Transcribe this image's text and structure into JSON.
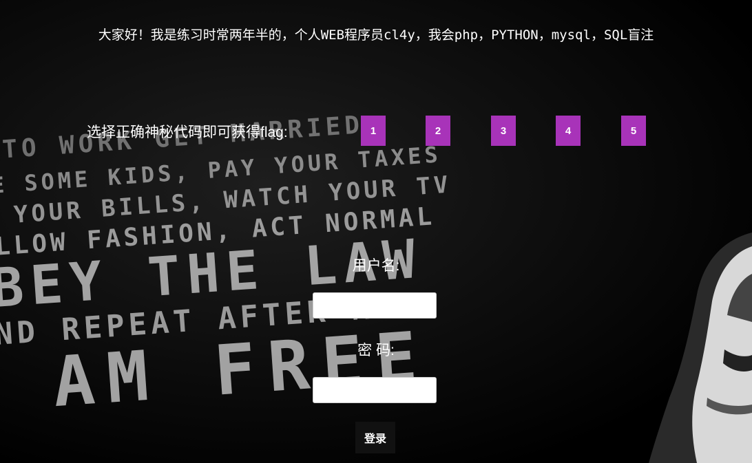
{
  "banner": {
    "text": "大家好！我是练习时常两年半的，个人WEB程序员cl4y，我会php，PYTHON，mysql，SQL盲注"
  },
  "secret_code": {
    "label": "选择正确神秘代码即可获得flag:",
    "buttons": [
      "1",
      "2",
      "3",
      "4",
      "5"
    ],
    "button_color": "#a833b9"
  },
  "login": {
    "username_label": "用户名:",
    "username_value": "",
    "password_label": "密 码:",
    "password_value": "",
    "submit_label": "登录"
  },
  "background": {
    "poster_lines": [
      "TO WORK GET MARRIED",
      "E SOME KIDS, PAY YOUR TAXES",
      "YOUR BILLS, WATCH YOUR TV",
      "LLOW FASHION, ACT NORMAL",
      "BEY THE LAW",
      "ND REPEAT AFTER ME:",
      "AM FREE"
    ]
  }
}
